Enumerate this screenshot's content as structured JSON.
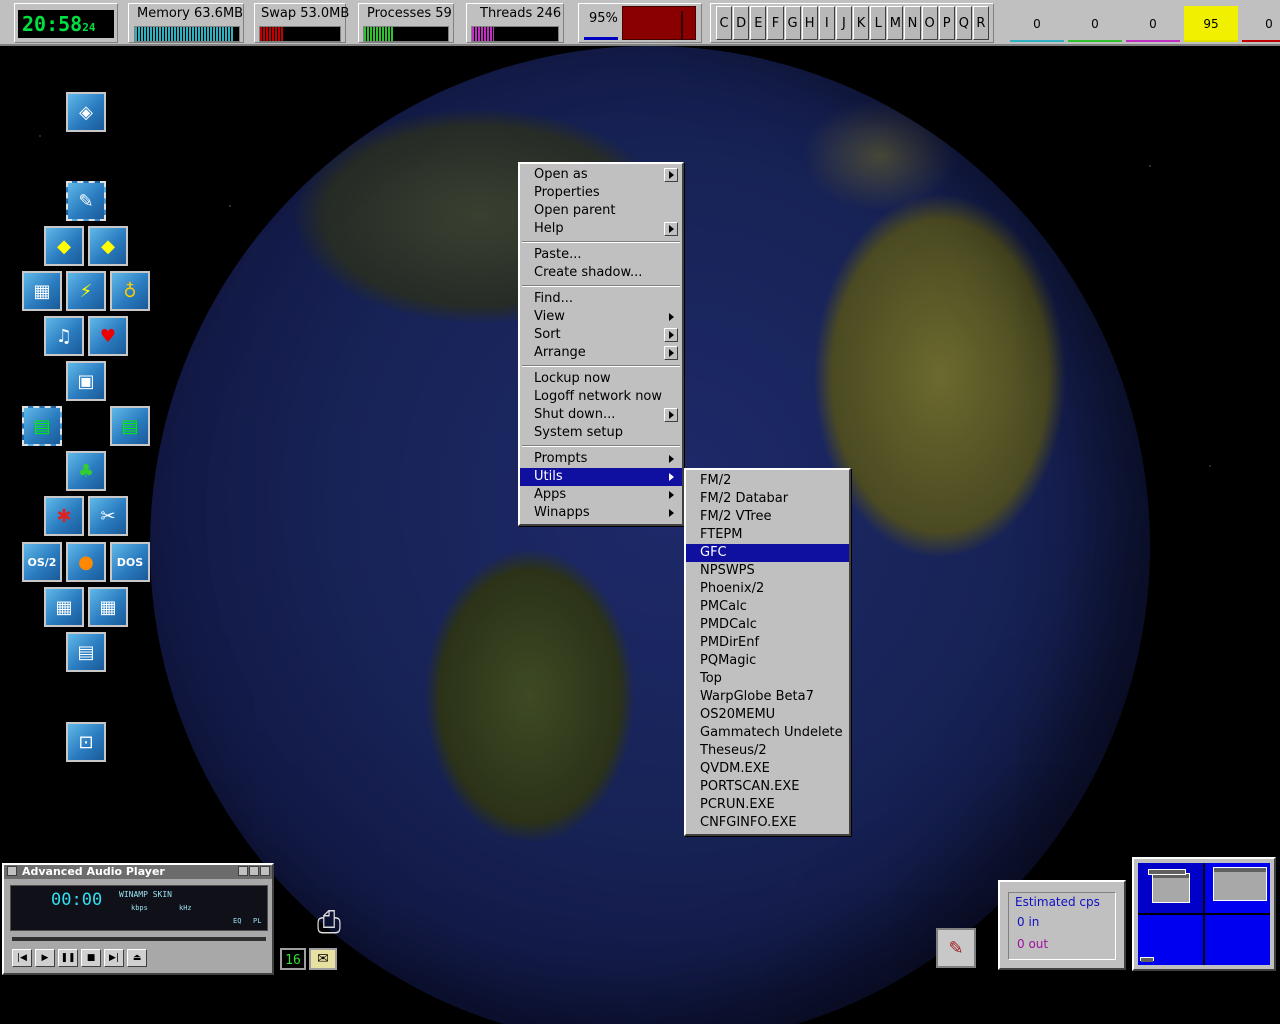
{
  "topbar": {
    "clock": {
      "hm": "20:58",
      "sec": "24"
    },
    "memory": {
      "label": "Memory 63.6MB",
      "level": 0.95,
      "color": "#30b0c0"
    },
    "swap": {
      "label": "Swap 53.0MB",
      "level": 0.3,
      "color": "#c00000"
    },
    "processes": {
      "label": "Processes 59",
      "level": 0.35,
      "color": "#30c030"
    },
    "threads": {
      "label": "Threads 246",
      "level": 0.25,
      "color": "#c030c0"
    },
    "cpu": {
      "label": "95%"
    },
    "drives": [
      "C",
      "D",
      "E",
      "F",
      "G",
      "H",
      "I",
      "J",
      "K",
      "L",
      "M",
      "N",
      "O",
      "P",
      "Q",
      "R"
    ],
    "counters": [
      {
        "value": "0",
        "color": "#30b0c0",
        "bg": "#c0c0c0"
      },
      {
        "value": "0",
        "color": "#30c030",
        "bg": "#c0c0c0"
      },
      {
        "value": "0",
        "color": "#c030c0",
        "bg": "#c0c0c0"
      },
      {
        "value": "95",
        "color": "#e0e000",
        "bg": "#f0f000"
      },
      {
        "value": "0",
        "color": "#c00000",
        "bg": "#c0c0c0"
      }
    ]
  },
  "dock": {
    "os2_label": "OS/2",
    "dos_label": "DOS"
  },
  "context_menu": {
    "items": [
      {
        "label": "Open as",
        "submenu": "box"
      },
      {
        "label": "Properties"
      },
      {
        "label": "Open parent"
      },
      {
        "label": "Help",
        "submenu": "box"
      },
      {
        "sep": true
      },
      {
        "label": "Paste..."
      },
      {
        "label": "Create shadow..."
      },
      {
        "sep": true
      },
      {
        "label": "Find..."
      },
      {
        "label": "View",
        "submenu": "plain"
      },
      {
        "label": "Sort",
        "submenu": "box"
      },
      {
        "label": "Arrange",
        "submenu": "box"
      },
      {
        "sep": true
      },
      {
        "label": "Lockup now"
      },
      {
        "label": "Logoff network now"
      },
      {
        "label": "Shut down...",
        "submenu": "box"
      },
      {
        "label": "System setup"
      },
      {
        "sep": true
      },
      {
        "label": "Prompts",
        "submenu": "plain"
      },
      {
        "label": "Utils",
        "submenu": "plain",
        "highlight": true
      },
      {
        "label": "Apps",
        "submenu": "plain"
      },
      {
        "label": "Winapps",
        "submenu": "plain"
      }
    ]
  },
  "utils_menu": {
    "items": [
      {
        "label": "FM/2"
      },
      {
        "label": "FM/2 Databar"
      },
      {
        "label": "FM/2 VTree"
      },
      {
        "label": "FTEPM"
      },
      {
        "label": "GFC",
        "highlight": true
      },
      {
        "label": "NPSWPS"
      },
      {
        "label": "Phoenix/2"
      },
      {
        "label": "PMCalc"
      },
      {
        "label": "PMDCalc"
      },
      {
        "label": "PMDirEnf"
      },
      {
        "label": "PQMagic"
      },
      {
        "label": "Top"
      },
      {
        "label": "WarpGlobe Beta7"
      },
      {
        "label": "OS20MEMU"
      },
      {
        "label": "Gammatech Undelete"
      },
      {
        "label": "Theseus/2"
      },
      {
        "label": "QVDM.EXE"
      },
      {
        "label": "PORTSCAN.EXE"
      },
      {
        "label": "PCRUN.EXE"
      },
      {
        "label": "CNFGINFO.EXE"
      }
    ]
  },
  "player": {
    "title": "Advanced Audio Player",
    "time": "00:00",
    "skin": "WINAMP SKIN",
    "kbps": "kbps",
    "khz": "kHz",
    "eq": "EQ",
    "pl": "PL",
    "buttons": [
      "|◀",
      "▶",
      "❚❚",
      "■",
      "▶|",
      "⏏"
    ]
  },
  "tray": {
    "counter": "16"
  },
  "cps": {
    "title": "Estimated cps",
    "in": "0 in",
    "out": "0 out"
  }
}
